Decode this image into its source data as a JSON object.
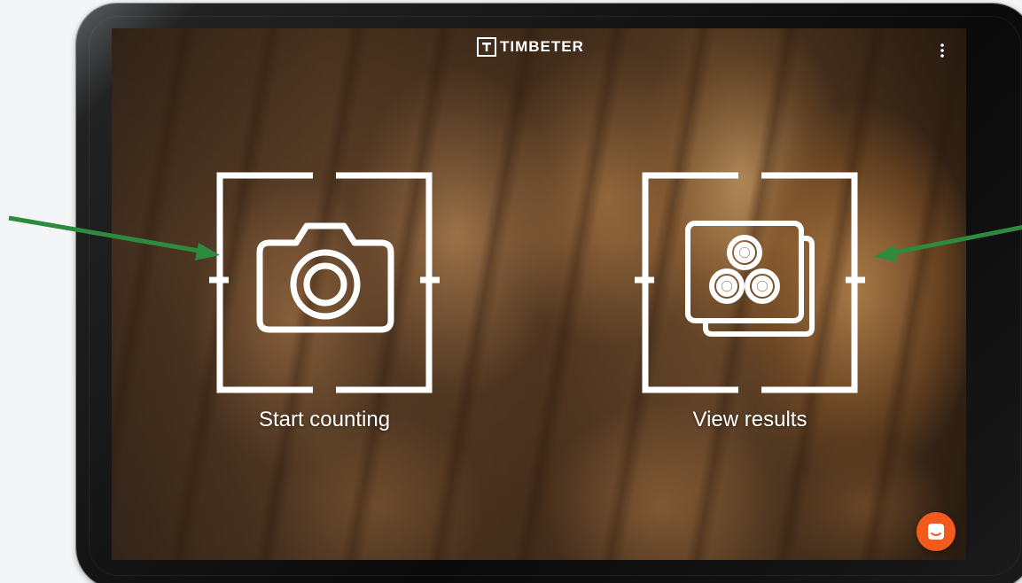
{
  "app": {
    "logo_text": "TIMBETER",
    "logo_icon": "timbeter-logo-icon",
    "menu_icon": "more-vertical-icon"
  },
  "actions": [
    {
      "label": "Start counting",
      "icon": "camera-icon"
    },
    {
      "label": "View results",
      "icon": "logs-gallery-icon"
    }
  ],
  "chat": {
    "icon": "chat-icon"
  },
  "colors": {
    "accent": "#f25b1d",
    "annotation_arrow": "#2e8b3e",
    "foreground": "#ffffff"
  }
}
